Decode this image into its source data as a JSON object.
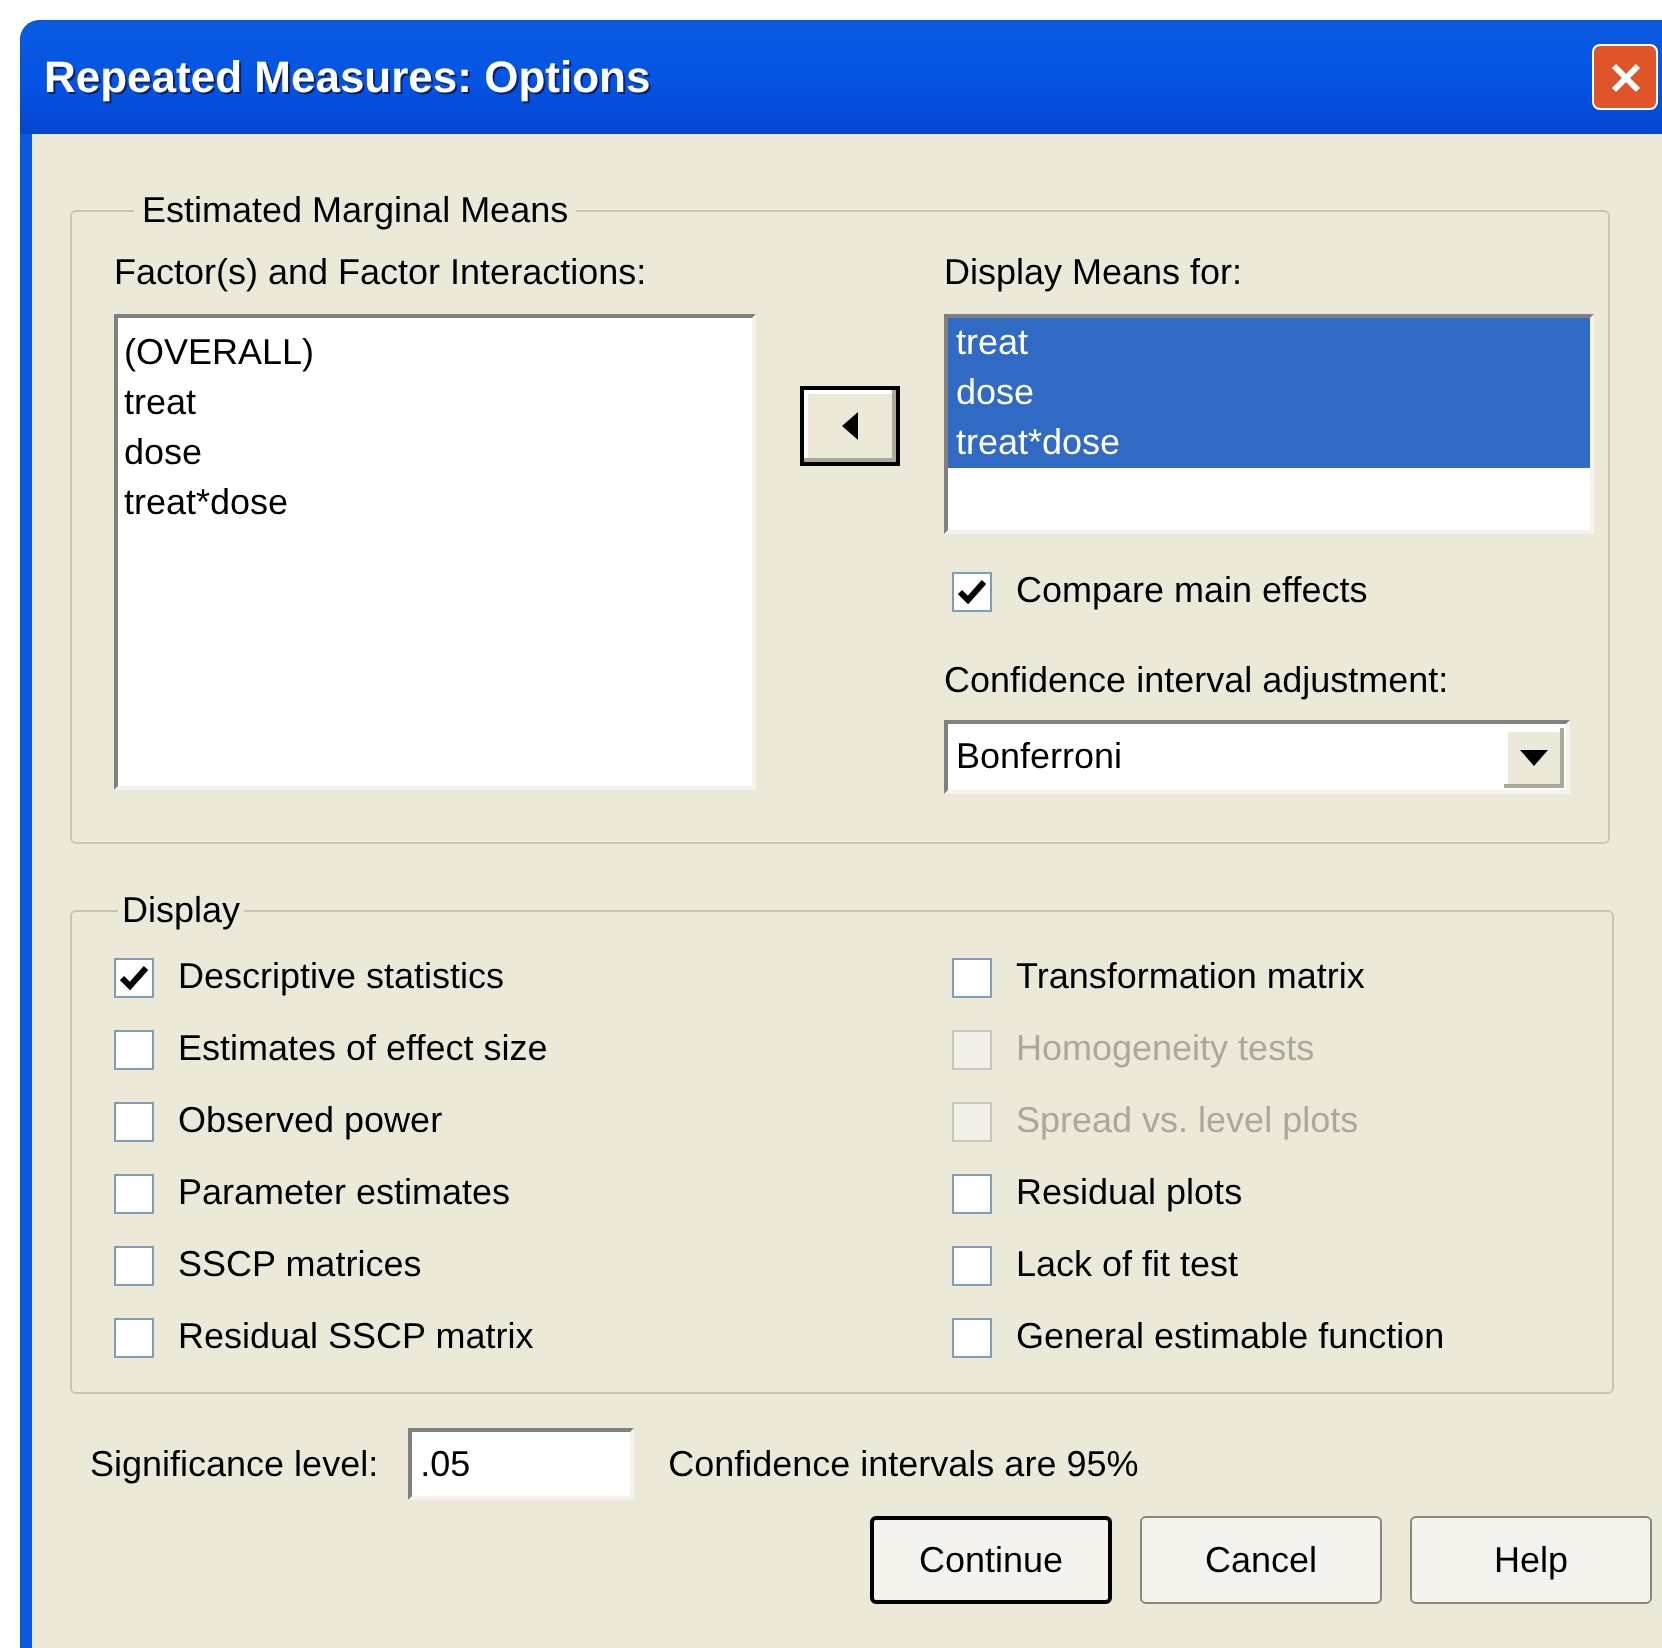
{
  "window": {
    "title": "Repeated Measures: Options"
  },
  "estimated_marginal_means": {
    "title": "Estimated Marginal Means",
    "factors_label": "Factor(s) and Factor Interactions:",
    "factors": [
      {
        "label": "(OVERALL)",
        "selected": false
      },
      {
        "label": "treat",
        "selected": false
      },
      {
        "label": "dose",
        "selected": false
      },
      {
        "label": "treat*dose",
        "selected": false
      }
    ],
    "display_means_label": "Display Means for:",
    "display_means": [
      {
        "label": "treat",
        "selected": true
      },
      {
        "label": "dose",
        "selected": true
      },
      {
        "label": "treat*dose",
        "selected": true
      }
    ],
    "compare_main_effects": {
      "label": "Compare main effects",
      "checked": true
    },
    "ci_adjustment_label": "Confidence interval adjustment:",
    "ci_adjustment": {
      "value": "Bonferroni"
    }
  },
  "display": {
    "title": "Display",
    "options": [
      {
        "label": "Descriptive statistics",
        "checked": true,
        "disabled": false
      },
      {
        "label": "Transformation matrix",
        "checked": false,
        "disabled": false
      },
      {
        "label": "Estimates of effect size",
        "checked": false,
        "disabled": false
      },
      {
        "label": "Homogeneity tests",
        "checked": false,
        "disabled": true
      },
      {
        "label": "Observed power",
        "checked": false,
        "disabled": false
      },
      {
        "label": "Spread vs. level plots",
        "checked": false,
        "disabled": true
      },
      {
        "label": "Parameter estimates",
        "checked": false,
        "disabled": false
      },
      {
        "label": "Residual plots",
        "checked": false,
        "disabled": false
      },
      {
        "label": "SSCP matrices",
        "checked": false,
        "disabled": false
      },
      {
        "label": "Lack of fit test",
        "checked": false,
        "disabled": false
      },
      {
        "label": "Residual SSCP matrix",
        "checked": false,
        "disabled": false
      },
      {
        "label": "General estimable function",
        "checked": false,
        "disabled": false
      }
    ]
  },
  "significance_level": {
    "label": "Significance level:",
    "value": ".05"
  },
  "ci_note": "Confidence intervals are 95%",
  "buttons": [
    {
      "label": "Continue",
      "default": true
    },
    {
      "label": "Cancel",
      "default": false
    },
    {
      "label": "Help",
      "default": false
    }
  ]
}
